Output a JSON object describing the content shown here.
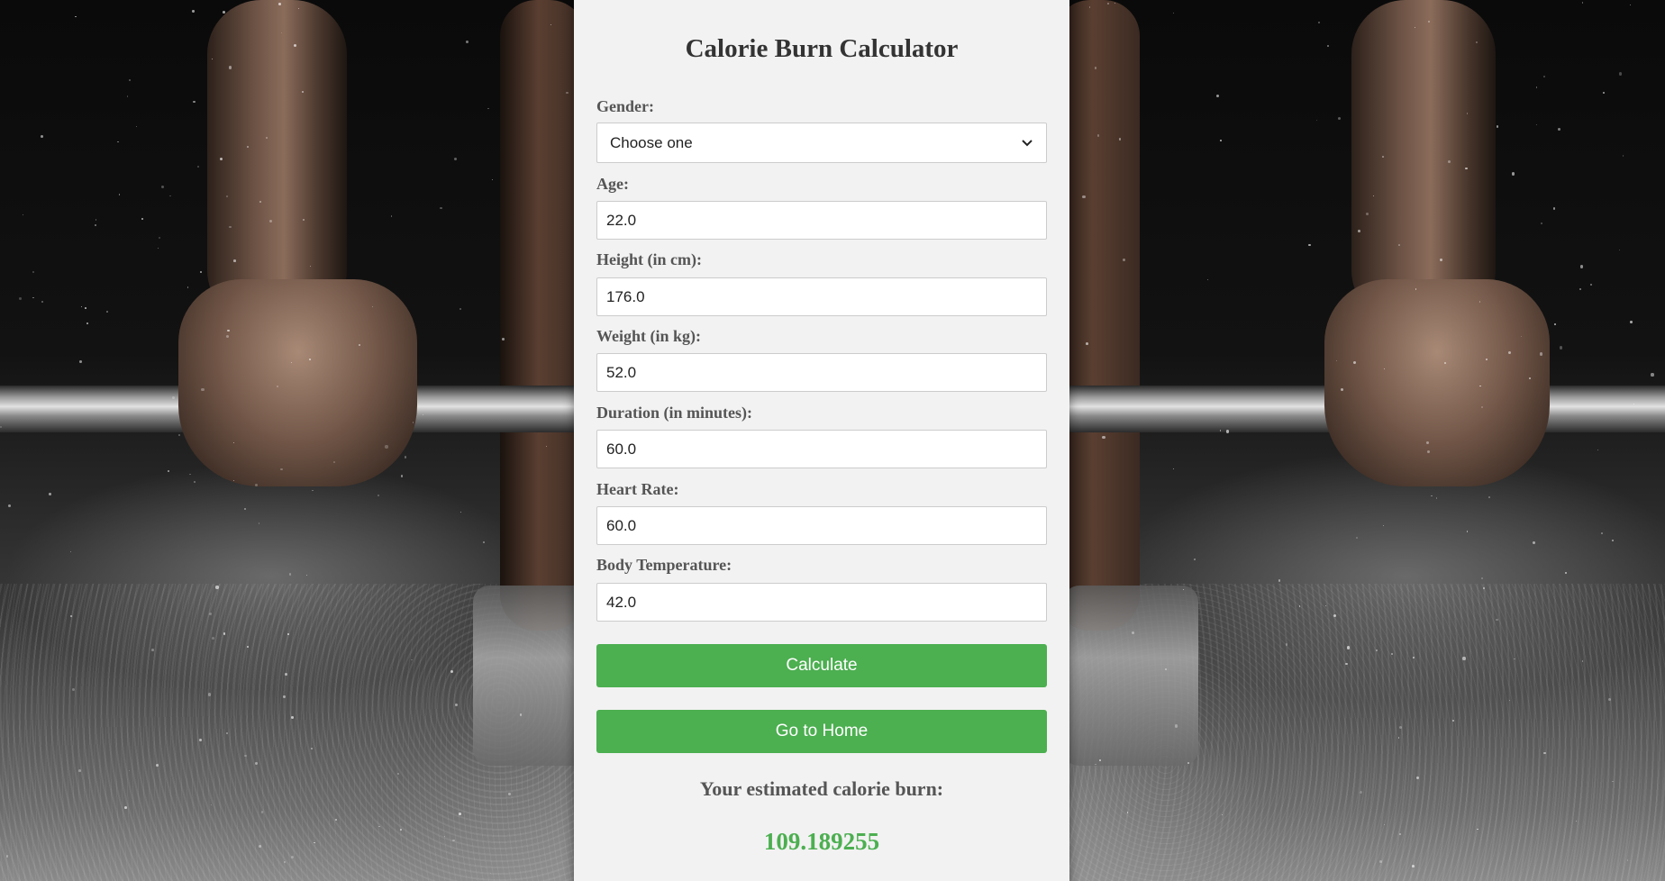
{
  "page": {
    "title": "Calorie Burn Calculator"
  },
  "form": {
    "gender": {
      "label": "Gender:",
      "selected": "Choose one"
    },
    "age": {
      "label": "Age:",
      "value": "22.0"
    },
    "height": {
      "label": "Height (in cm):",
      "value": "176.0"
    },
    "weight": {
      "label": "Weight (in kg):",
      "value": "52.0"
    },
    "duration": {
      "label": "Duration (in minutes):",
      "value": "60.0"
    },
    "heart_rate": {
      "label": "Heart Rate:",
      "value": "60.0"
    },
    "body_temp": {
      "label": "Body Temperature:",
      "value": "42.0"
    },
    "select_icon": "chevron-down-icon"
  },
  "buttons": {
    "calculate": "Calculate",
    "home": "Go to Home",
    "color": "#4caf50"
  },
  "result": {
    "label": "Your estimated calorie burn:",
    "value": "109.189255",
    "color": "#4caf50"
  }
}
